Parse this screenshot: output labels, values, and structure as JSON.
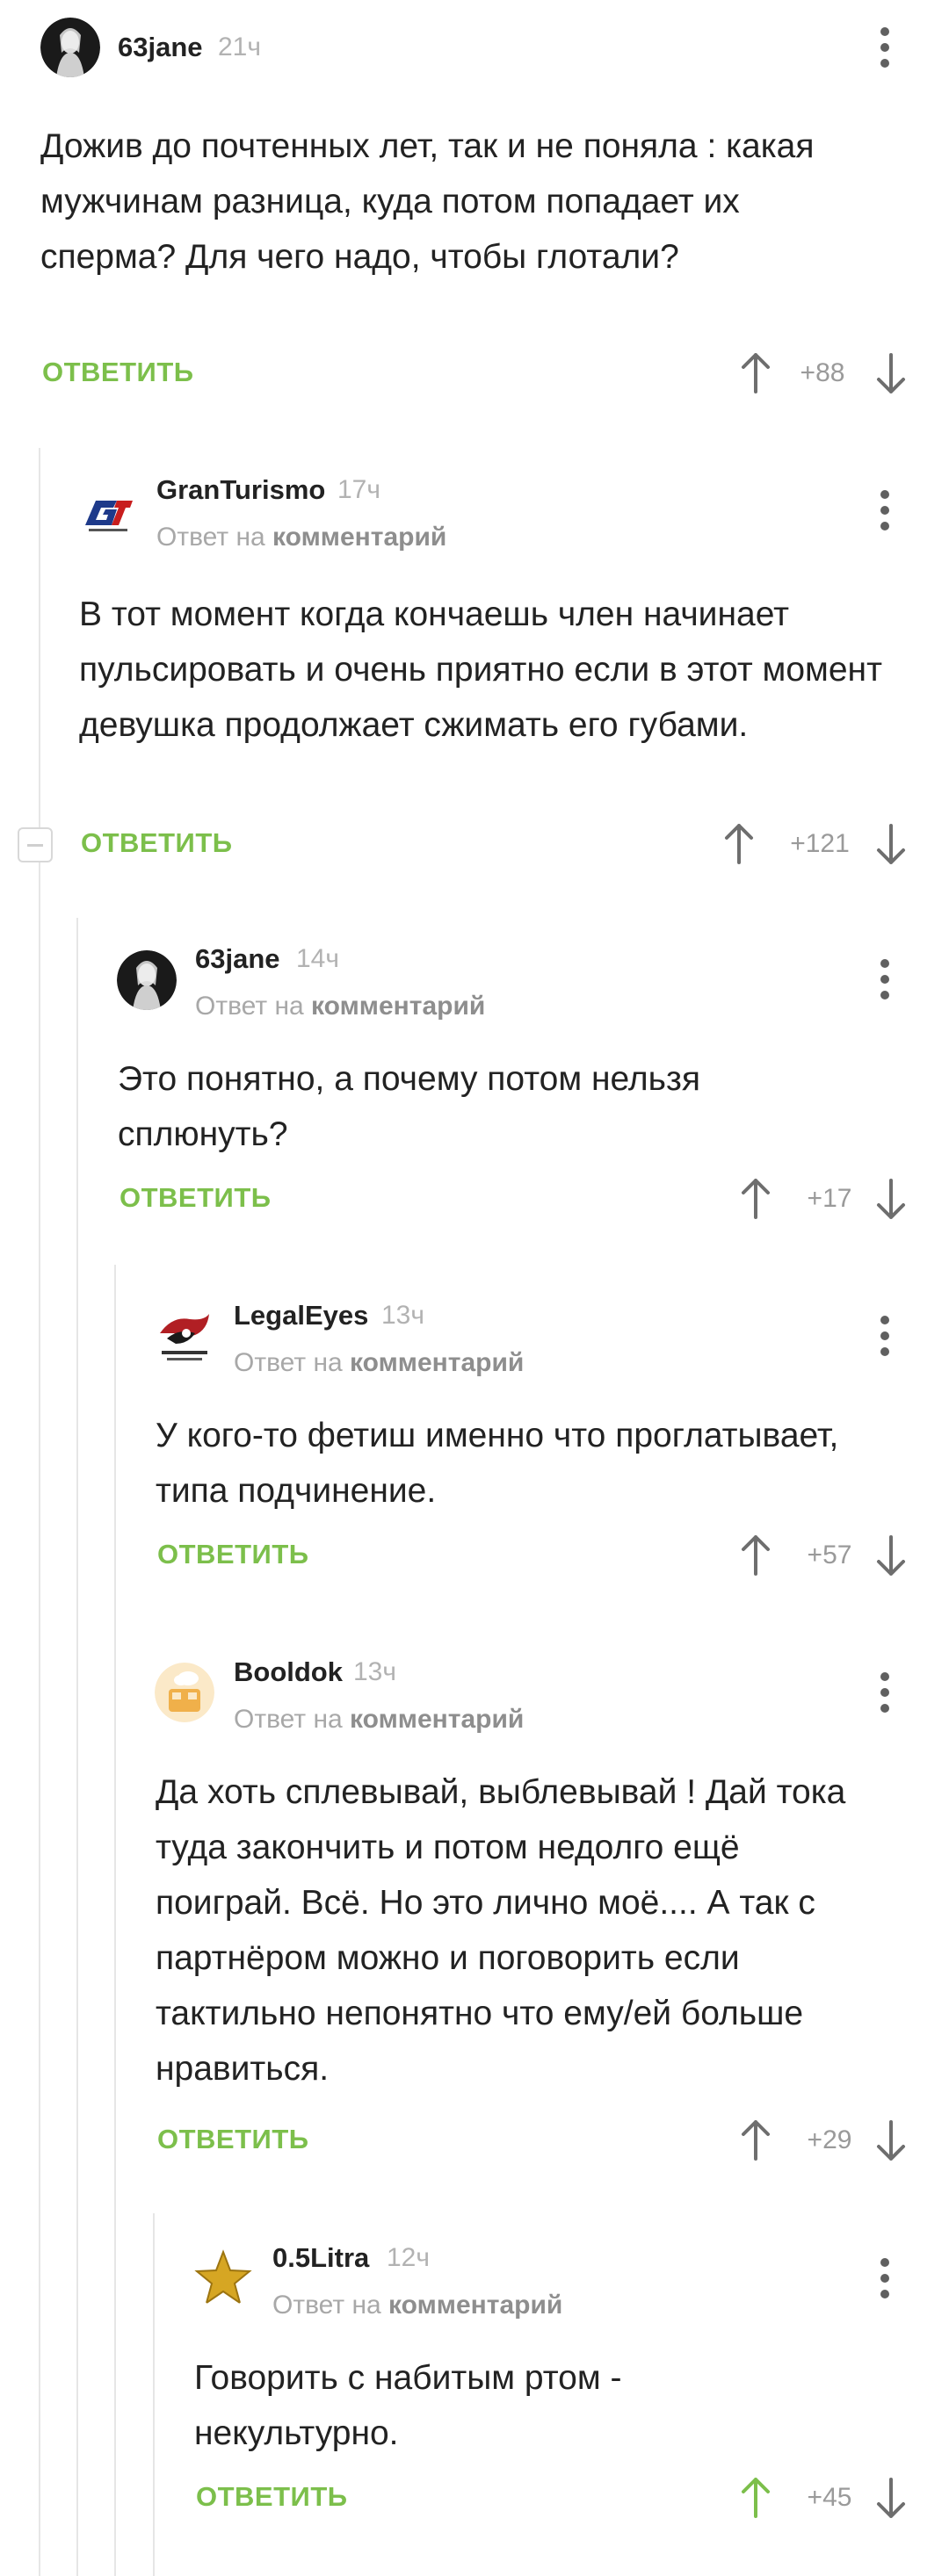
{
  "comments": [
    {
      "author": "63jane",
      "time": "21ч",
      "text": "Дожив до почтенных лет, так и не поняла : какая мужчинам разница, куда потом попадает их сперма? Для чего  надо, чтобы глотали?",
      "reply_label": "ОТВЕТИТЬ",
      "score": "+88",
      "avatar": "dark-figure"
    },
    {
      "author": "GranTurismo",
      "time": "17ч",
      "reply_prefix": "Ответ на",
      "reply_link": "комментарий",
      "text": "В тот момент когда кончаешь член начинает пульсировать и очень приятно если в этот момент девушка продолжает сжимать его губами.",
      "reply_label": "ОТВЕТИТЬ",
      "score": "+121",
      "avatar": "gt-logo"
    },
    {
      "author": "63jane",
      "time": "14ч",
      "reply_prefix": "Ответ на",
      "reply_link": "комментарий",
      "text": "Это понятно, а почему потом нельзя сплюнуть?",
      "reply_label": "ОТВЕТИТЬ",
      "score": "+17",
      "avatar": "dark-figure"
    },
    {
      "author": "LegalEyes",
      "time": "13ч",
      "reply_prefix": "Ответ на",
      "reply_link": "комментарий",
      "text": "У кого-то фетиш именно что проглатывает, типа подчинение.",
      "reply_label": "ОТВЕТИТЬ",
      "score": "+57",
      "avatar": "rog-logo"
    },
    {
      "author": "Booldok",
      "time": "13ч",
      "reply_prefix": "Ответ на",
      "reply_link": "комментарий",
      "text": "Да хоть сплевывай, выблевывай ! Дай тока туда закончить и потом недолго ещё поиграй. Всё. Но это лично моё.... А так с партнёром можно и поговорить если тактильно непонятно что ему/ей больше нравиться.",
      "reply_label": "ОТВЕТИТЬ",
      "score": "+29",
      "avatar": "cartoon"
    },
    {
      "author": "0.5Litra",
      "time": "12ч",
      "reply_prefix": "Ответ на",
      "reply_link": "комментарий",
      "text": "Говорить с набитым ртом - некультурно.",
      "reply_label": "ОТВЕТИТЬ",
      "score": "+45",
      "avatar": "gold-star"
    }
  ],
  "colors": {
    "accent": "#7cbf4b",
    "text": "#222222",
    "muted": "#a8a8a8",
    "upvoted": "#7cbf4b"
  }
}
